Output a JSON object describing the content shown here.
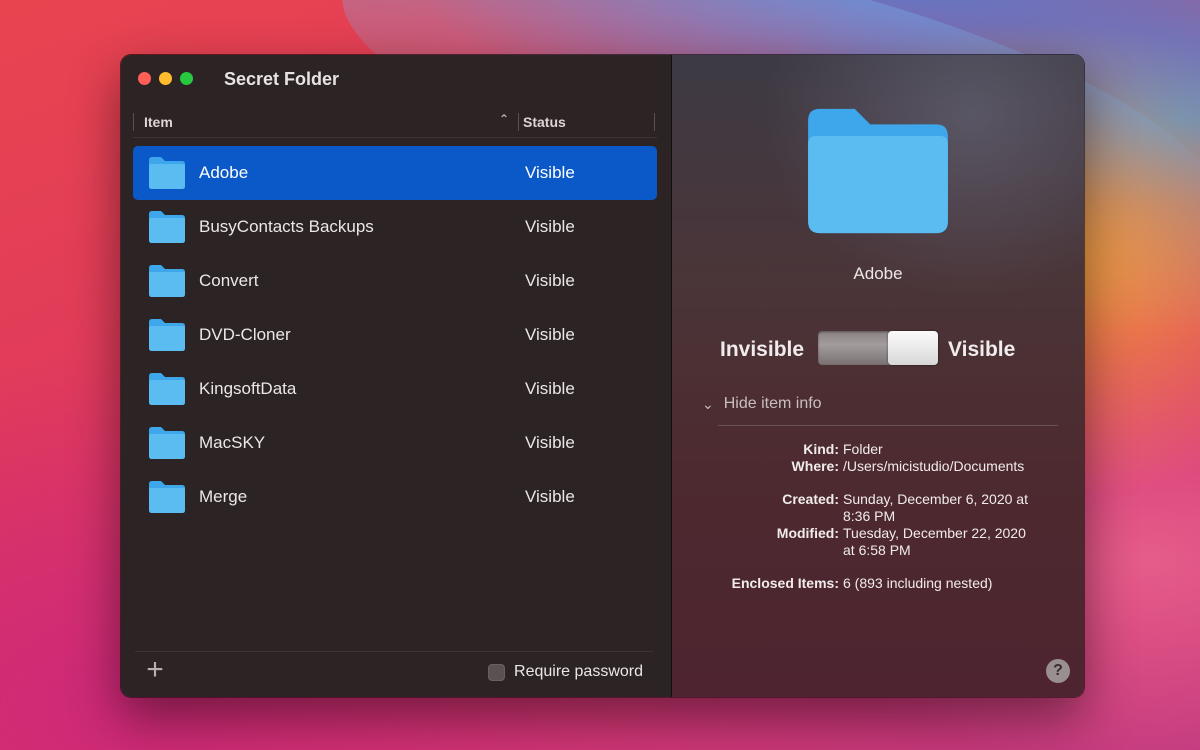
{
  "window": {
    "title": "Secret Folder"
  },
  "list": {
    "columns": {
      "item": "Item",
      "status": "Status"
    },
    "rows": [
      {
        "name": "Adobe",
        "status": "Visible",
        "selected": true
      },
      {
        "name": "BusyContacts Backups",
        "status": "Visible"
      },
      {
        "name": "Convert",
        "status": "Visible"
      },
      {
        "name": "DVD-Cloner",
        "status": "Visible"
      },
      {
        "name": "KingsoftData",
        "status": "Visible"
      },
      {
        "name": "MacSKY",
        "status": "Visible"
      },
      {
        "name": "Merge",
        "status": "Visible"
      }
    ]
  },
  "footer": {
    "add_symbol": "+",
    "require_password": "Require password",
    "require_password_checked": false
  },
  "detail": {
    "name": "Adobe",
    "toggle": {
      "left_label": "Invisible",
      "right_label": "Visible",
      "state": "Visible"
    },
    "hide_info_label": "Hide item info",
    "info": {
      "kind_label": "Kind:",
      "kind": "Folder",
      "where_label": "Where:",
      "where": "/Users/micistudio/Documents",
      "created_label": "Created:",
      "created_line1": "Sunday, December 6, 2020 at",
      "created_line2": "8:36 PM",
      "modified_label": "Modified:",
      "modified_line1": "Tuesday, December 22, 2020",
      "modified_line2": "at 6:58 PM",
      "enclosed_label": "Enclosed Items:",
      "enclosed": "6 (893 including nested)"
    },
    "help_symbol": "?"
  },
  "colors": {
    "selection": "#0b59c9",
    "folder": "#5bbcf2"
  }
}
